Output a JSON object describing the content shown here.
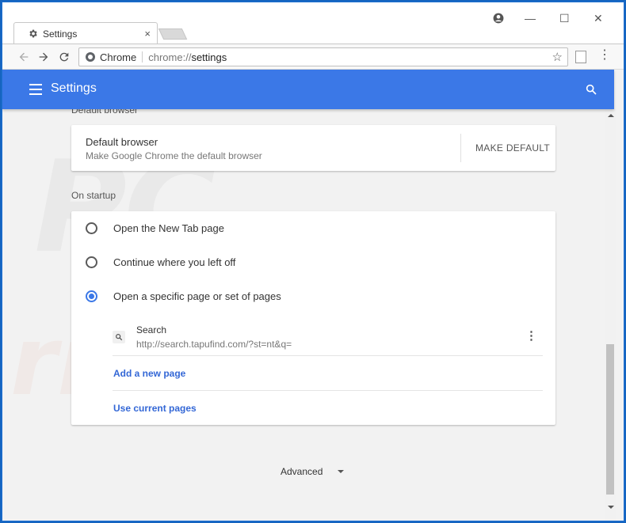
{
  "browser": {
    "tab": {
      "title": "Settings",
      "close": "×"
    },
    "window_controls": {
      "minimize": "—",
      "maximize": "☐",
      "close": "✕"
    },
    "omnibox": {
      "origin_label": "Chrome",
      "scheme": "chrome://",
      "host": "settings"
    },
    "star": "☆",
    "menu": "⋮"
  },
  "appbar": {
    "title": "Settings"
  },
  "default_browser": {
    "section_label": "Default browser",
    "title": "Default browser",
    "subtitle": "Make Google Chrome the default browser",
    "button": "MAKE DEFAULT"
  },
  "on_startup": {
    "section_label": "On startup",
    "options": [
      {
        "label": "Open the New Tab page",
        "selected": false
      },
      {
        "label": "Continue where you left off",
        "selected": false
      },
      {
        "label": "Open a specific page or set of pages",
        "selected": true
      }
    ],
    "page": {
      "title": "Search",
      "url": "http://search.tapufind.com/?st=nt&q="
    },
    "add_page": "Add a new page",
    "use_current": "Use current pages"
  },
  "advanced": {
    "label": "Advanced"
  },
  "colors": {
    "accent": "#3b78e7",
    "link": "#3367d6",
    "frame": "#1565c0"
  },
  "icons": {
    "tab": "gear-icon",
    "back": "back-arrow-icon",
    "forward": "forward-arrow-icon",
    "reload": "reload-icon",
    "hamburger": "hamburger-menu-icon",
    "search": "search-icon",
    "page": "magnifier-icon",
    "more": "kebab-menu-icon"
  }
}
